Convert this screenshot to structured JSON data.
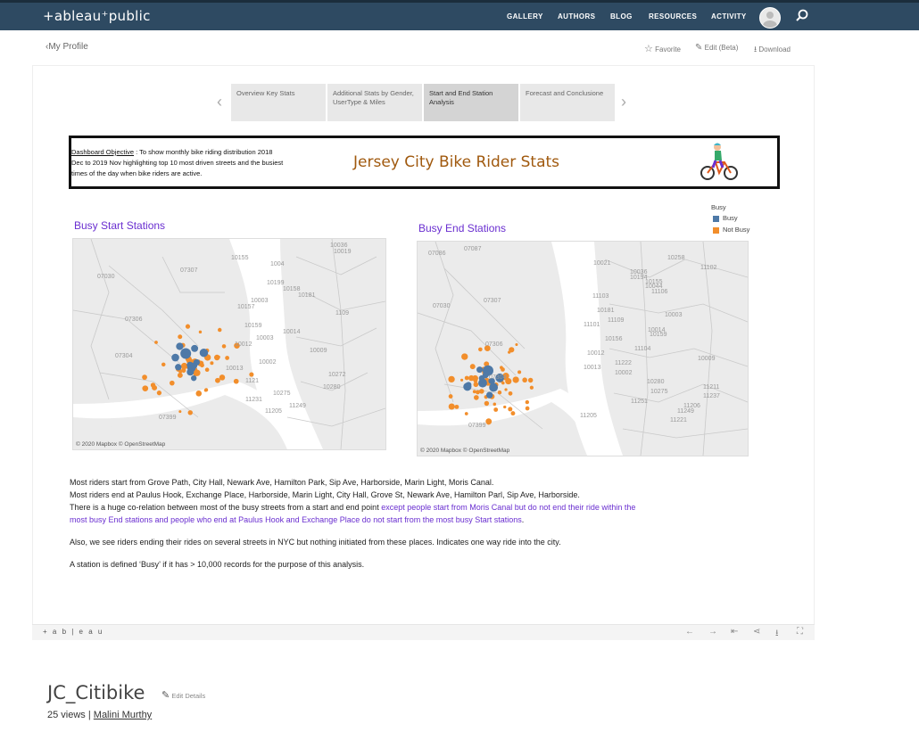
{
  "header": {
    "logo": "+ableau⁺public",
    "nav": [
      "GALLERY",
      "AUTHORS",
      "BLOG",
      "RESOURCES",
      "ACTIVITY"
    ]
  },
  "subbar": {
    "back": "My Profile",
    "favorite": "Favorite",
    "edit": "Edit (Beta)",
    "download": "Download"
  },
  "story": {
    "tabs": [
      {
        "label": "Overview Key Stats",
        "active": false
      },
      {
        "label": "Additional Stats by Gender, UserType & Miles",
        "active": false
      },
      {
        "label": "Start and End Station Analysis",
        "active": true
      },
      {
        "label": "Forecast and Conclusione",
        "active": false
      }
    ]
  },
  "dashboard": {
    "objective_label": "Dashboard Objective",
    "objective_text": " : To show monthly bike riding distribution 2018 Dec to 2019 Nov highlighting top 10 most driven streets and the busiest times of the day when bike riders are active.",
    "title": "Jersey City Bike Rider Stats",
    "start_title": "Busy Start Stations",
    "end_title": "Busy End Stations",
    "attribution": "© 2020 Mapbox © OpenStreetMap",
    "legend": {
      "title": "Busy",
      "items": [
        {
          "label": "Busy",
          "color": "#4e79a7"
        },
        {
          "label": "Not Busy",
          "color": "#f28e2b"
        }
      ]
    },
    "start_map_labels": [
      "10036",
      "10019",
      "10155",
      "1004",
      "07307",
      "07030",
      "10199",
      "10158",
      "10181",
      "10003",
      "10157",
      "1109",
      "07306",
      "10159",
      "10014",
      "10003",
      "10012",
      "10009",
      "07304",
      "10002",
      "10013",
      "10272",
      "1121",
      "10280",
      "10275",
      "11231",
      "11249",
      "11205",
      "07399"
    ],
    "end_map_labels": [
      "07087",
      "07086",
      "10258",
      "10021",
      "11102",
      "10036",
      "10194",
      "10155",
      "10044",
      "11106",
      "11103",
      "07307",
      "07030",
      "10181",
      "10003",
      "11109",
      "11101",
      "10014",
      "10159",
      "10156",
      "07306",
      "11104",
      "10012",
      "10009",
      "11222",
      "10013",
      "10002",
      "07304",
      "10280",
      "11211",
      "10275",
      "11237",
      "11251",
      "11206",
      "11249",
      "11205",
      "11221",
      "07399"
    ],
    "paragraphs": [
      "Most riders start from Grove Path, City Hall, Newark Ave, Hamilton Park, Sip Ave, Harborside, Marin Light, Moris Canal.",
      "Most riders end at Paulus Hook, Exchange Place, Harborside, Marin Light, City Hall, Grove St, Newark Ave, Hamilton Parl, Sip Ave, Harborside.",
      "There is a huge co-relation between most of the busy streets from a start and end point ",
      "except people start from Moris Canal but do not end their ride within the",
      "most busy End stations and people who end at Paulus Hook and Exchange Place do not start from the most busy Start stations",
      ".",
      "Also, we see riders ending their rides on several streets in NYC but nothing initiated from these places. Indicates one way ride into the city.",
      "A station is defined ‘Busy’ if it has > 10,000 records for the purpose of this analysis."
    ]
  },
  "footer_bar": {
    "logo": "+ a b | e a u"
  },
  "workbook": {
    "title": "JC_Citibike",
    "edit_details": "Edit Details",
    "views": "25 views | ",
    "author": "Malini Murthy"
  }
}
